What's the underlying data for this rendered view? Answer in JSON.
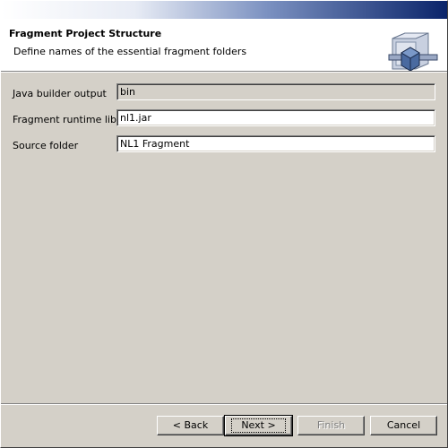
{
  "banner": {
    "title": "Fragment Project Structure",
    "description": "Define names of the essential fragment folders"
  },
  "form": {
    "builder_output_label": "Java builder output",
    "builder_output_value": "bin",
    "runtime_library_label": "Fragment runtime library",
    "runtime_library_value": "nl1.jar",
    "source_folder_label": "Source folder",
    "source_folder_value": "NL1 Fragment"
  },
  "buttons": {
    "back": "< Back",
    "next": "Next >",
    "finish": "Finish",
    "cancel": "Cancel",
    "finish_enabled": false
  },
  "icons": {
    "banner": "fragment-wizard-icon"
  },
  "colors": {
    "title_gradient_end": "#0a246a",
    "dialog_bg": "#d4d0c8"
  }
}
